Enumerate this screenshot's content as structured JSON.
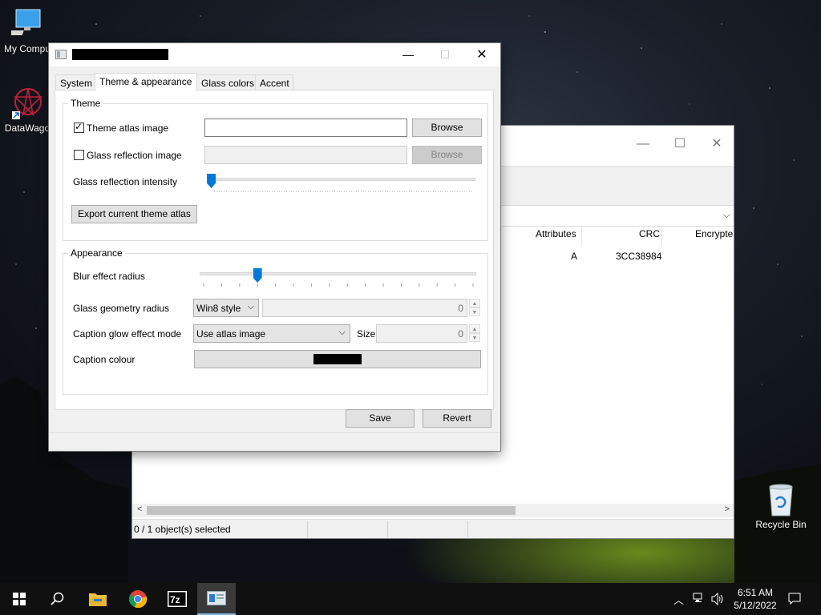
{
  "desktop": {
    "icons": [
      {
        "label": "My Compu",
        "icon": "computer-icon"
      },
      {
        "label": "DataWago",
        "icon": "datawagon-icon"
      },
      {
        "label": "Recycle Bin",
        "icon": "recycle-bin-icon"
      }
    ]
  },
  "background_window": {
    "columns": [
      "Attributes",
      "CRC",
      "Encrypte"
    ],
    "row": {
      "attributes": "A",
      "crc": "3CC38984"
    },
    "status": "0 / 1 object(s) selected"
  },
  "dialog": {
    "tabs": [
      "System",
      "Theme & appearance",
      "Glass colors",
      "Accent"
    ],
    "active_tab": "Theme & appearance",
    "theme_group": {
      "legend": "Theme",
      "theme_atlas_label": "Theme atlas image",
      "theme_atlas_checked": true,
      "theme_atlas_value": "",
      "browse_label": "Browse",
      "glass_reflection_label": "Glass reflection image",
      "glass_reflection_checked": false,
      "glass_reflection_value": "",
      "browse2_label": "Browse",
      "intensity_label": "Glass reflection intensity",
      "intensity_value": 0,
      "export_label": "Export current theme atlas"
    },
    "appearance_group": {
      "legend": "Appearance",
      "blur_label": "Blur effect radius",
      "blur_value": 0.2,
      "geometry_label": "Glass geometry radius",
      "geometry_style": "Win8 style",
      "geometry_value": "0",
      "glow_label": "Caption glow effect mode",
      "glow_mode": "Use atlas image",
      "size_label": "Size",
      "size_value": "0",
      "caption_colour_label": "Caption colour",
      "caption_colour": "#000000"
    },
    "save_label": "Save",
    "revert_label": "Revert"
  },
  "taskbar": {
    "items": [
      "start-icon",
      "search-icon",
      "file-explorer-icon",
      "chrome-icon",
      "7zip-icon",
      "app-window-icon"
    ],
    "time": "6:51 AM",
    "date": "5/12/2022"
  },
  "colors": {
    "accent": "#0078d7",
    "taskbar": "#101010",
    "dialog_bg": "#f0f0f0"
  }
}
